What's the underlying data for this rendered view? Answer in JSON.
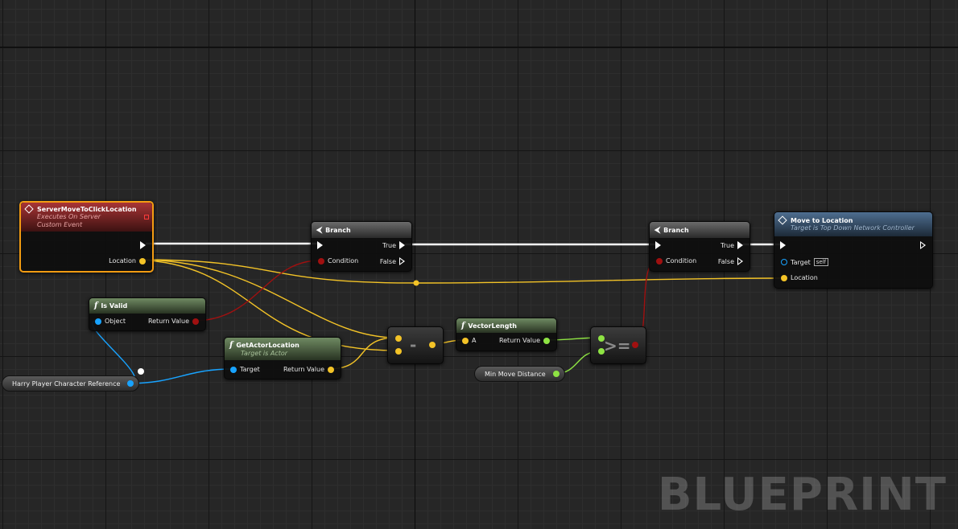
{
  "watermark": "BLUEPRINT",
  "colors": {
    "exec": "#ffffff",
    "vector": "#f3c327",
    "object": "#18a3ff",
    "boolean": "#a01010",
    "float": "#8ee343",
    "selection": "#f39c12"
  },
  "nodes": {
    "server_event": {
      "title": "ServerMoveToClickLocation",
      "sub1": "Executes On Server",
      "sub2": "Custom Event",
      "pin_location": "Location"
    },
    "branch1": {
      "title": "Branch",
      "pin_condition": "Condition",
      "pin_true": "True",
      "pin_false": "False"
    },
    "branch2": {
      "title": "Branch",
      "pin_condition": "Condition",
      "pin_true": "True",
      "pin_false": "False"
    },
    "move_to_location": {
      "title": "Move to Location",
      "sub": "Target is Top Down Network Controller",
      "pin_target": "Target",
      "target_default": "self",
      "pin_location": "Location"
    },
    "is_valid": {
      "title": "Is Valid",
      "pin_object": "Object",
      "pin_return": "Return Value"
    },
    "get_actor_location": {
      "title": "GetActorLocation",
      "sub": "Target is Actor",
      "pin_target": "Target",
      "pin_return": "Return Value"
    },
    "subtract": {
      "symbol": "-"
    },
    "vector_length": {
      "title": "VectorLength",
      "pin_a": "A",
      "pin_return": "Return Value"
    },
    "compare": {
      "symbol": ">="
    },
    "var_player": {
      "label": "Harry Player Character Reference"
    },
    "var_min_distance": {
      "label": "Min Move Distance"
    }
  }
}
